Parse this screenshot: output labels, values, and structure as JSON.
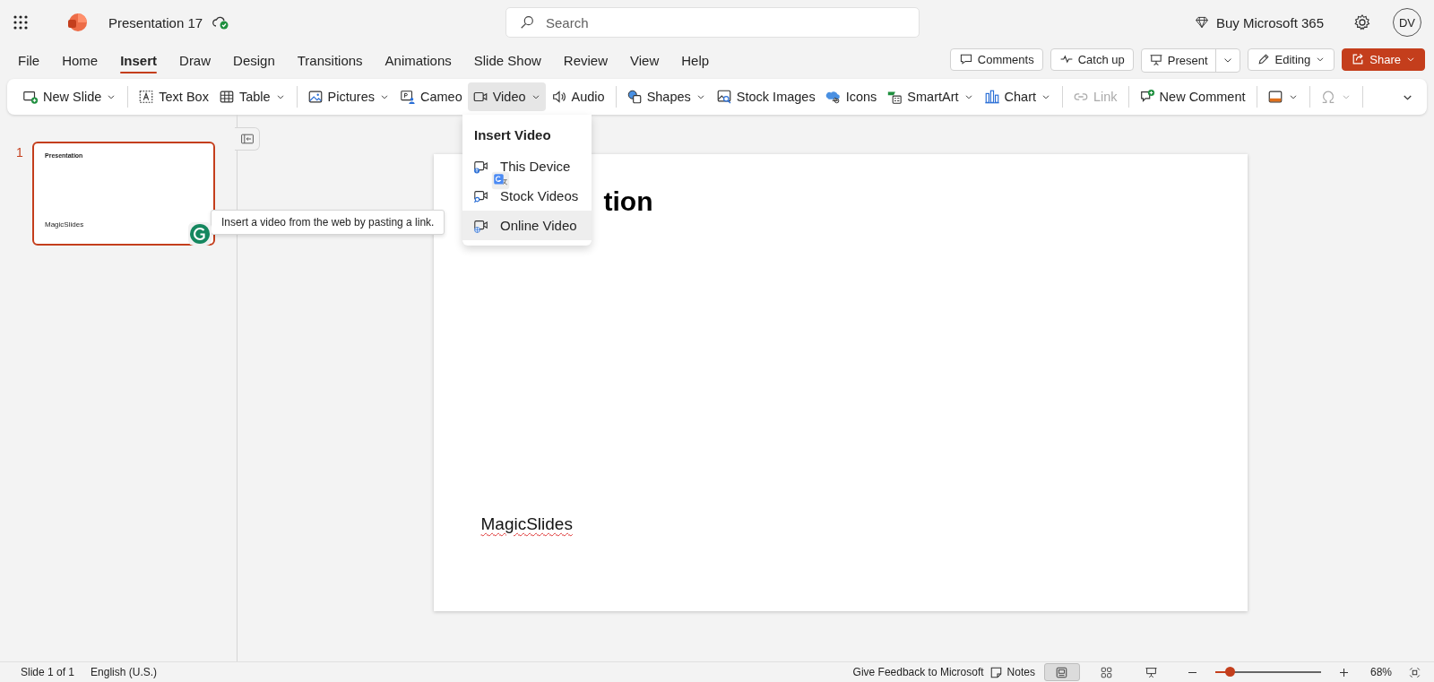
{
  "app": {
    "title": "Presentation 17"
  },
  "search": {
    "placeholder": "Search"
  },
  "header": {
    "buy": "Buy Microsoft 365",
    "avatar": "DV"
  },
  "tabs": [
    {
      "label": "File",
      "selected": false
    },
    {
      "label": "Home",
      "selected": false
    },
    {
      "label": "Insert",
      "selected": true
    },
    {
      "label": "Draw",
      "selected": false
    },
    {
      "label": "Design",
      "selected": false
    },
    {
      "label": "Transitions",
      "selected": false
    },
    {
      "label": "Animations",
      "selected": false
    },
    {
      "label": "Slide Show",
      "selected": false
    },
    {
      "label": "Review",
      "selected": false
    },
    {
      "label": "View",
      "selected": false
    },
    {
      "label": "Help",
      "selected": false
    }
  ],
  "actions": [
    {
      "label": "Comments",
      "kind": "plain"
    },
    {
      "label": "Catch up",
      "kind": "plain"
    },
    {
      "label": "Present",
      "kind": "split"
    },
    {
      "label": "Editing",
      "kind": "menu"
    },
    {
      "label": "Share",
      "kind": "primary"
    }
  ],
  "ribbon": [
    {
      "kind": "button",
      "label": "New Slide",
      "dropdown": true,
      "expanded": false,
      "disabled": false
    },
    {
      "kind": "separator"
    },
    {
      "kind": "button",
      "label": "Text Box",
      "dropdown": false,
      "expanded": false,
      "disabled": false
    },
    {
      "kind": "button",
      "label": "Table",
      "dropdown": true,
      "expanded": false,
      "disabled": false
    },
    {
      "kind": "separator"
    },
    {
      "kind": "button",
      "label": "Pictures",
      "dropdown": true,
      "expanded": false,
      "disabled": false
    },
    {
      "kind": "button",
      "label": "Cameo",
      "dropdown": false,
      "expanded": false,
      "disabled": false
    },
    {
      "kind": "button",
      "label": "Video",
      "dropdown": true,
      "expanded": true,
      "disabled": false
    },
    {
      "kind": "button",
      "label": "Audio",
      "dropdown": false,
      "expanded": false,
      "disabled": false
    },
    {
      "kind": "separator"
    },
    {
      "kind": "button",
      "label": "Shapes",
      "dropdown": true,
      "expanded": false,
      "disabled": false
    },
    {
      "kind": "button",
      "label": "Stock Images",
      "dropdown": false,
      "expanded": false,
      "disabled": false
    },
    {
      "kind": "button",
      "label": "Icons",
      "dropdown": false,
      "expanded": false,
      "disabled": false
    },
    {
      "kind": "button",
      "label": "SmartArt",
      "dropdown": true,
      "expanded": false,
      "disabled": false
    },
    {
      "kind": "button",
      "label": "Chart",
      "dropdown": true,
      "expanded": false,
      "disabled": false
    },
    {
      "kind": "separator"
    },
    {
      "kind": "button",
      "label": "Link",
      "dropdown": false,
      "expanded": false,
      "disabled": true
    },
    {
      "kind": "separator"
    },
    {
      "kind": "button",
      "label": "New Comment",
      "dropdown": false,
      "expanded": false,
      "disabled": false
    },
    {
      "kind": "separator"
    },
    {
      "kind": "icon",
      "dropdown": true,
      "expanded": false,
      "disabled": false
    },
    {
      "kind": "separator"
    },
    {
      "kind": "icon",
      "dropdown": true,
      "expanded": false,
      "disabled": true
    },
    {
      "kind": "separator"
    }
  ],
  "video_menu": {
    "title": "Insert Video",
    "items": [
      {
        "label": "This Device",
        "selected": false
      },
      {
        "label": "Stock Videos",
        "selected": false
      },
      {
        "label": "Online Video",
        "selected": true
      }
    ]
  },
  "tooltip": "Insert a video from the web by pasting a link.",
  "thumbnails": [
    {
      "number": "1",
      "title": "Presentation",
      "footer": "MagicSlides",
      "selected": true
    }
  ],
  "slide": {
    "title": "tion",
    "footer": "MagicSlides"
  },
  "status": {
    "slide": "Slide 1 of 1",
    "language": "English (U.S.)",
    "feedback": "Give Feedback to Microsoft",
    "notes": "Notes",
    "views": [
      {
        "selected": true
      },
      {
        "selected": false
      },
      {
        "selected": false
      }
    ],
    "zoom": {
      "level": 0.14,
      "reading": "68%"
    }
  }
}
